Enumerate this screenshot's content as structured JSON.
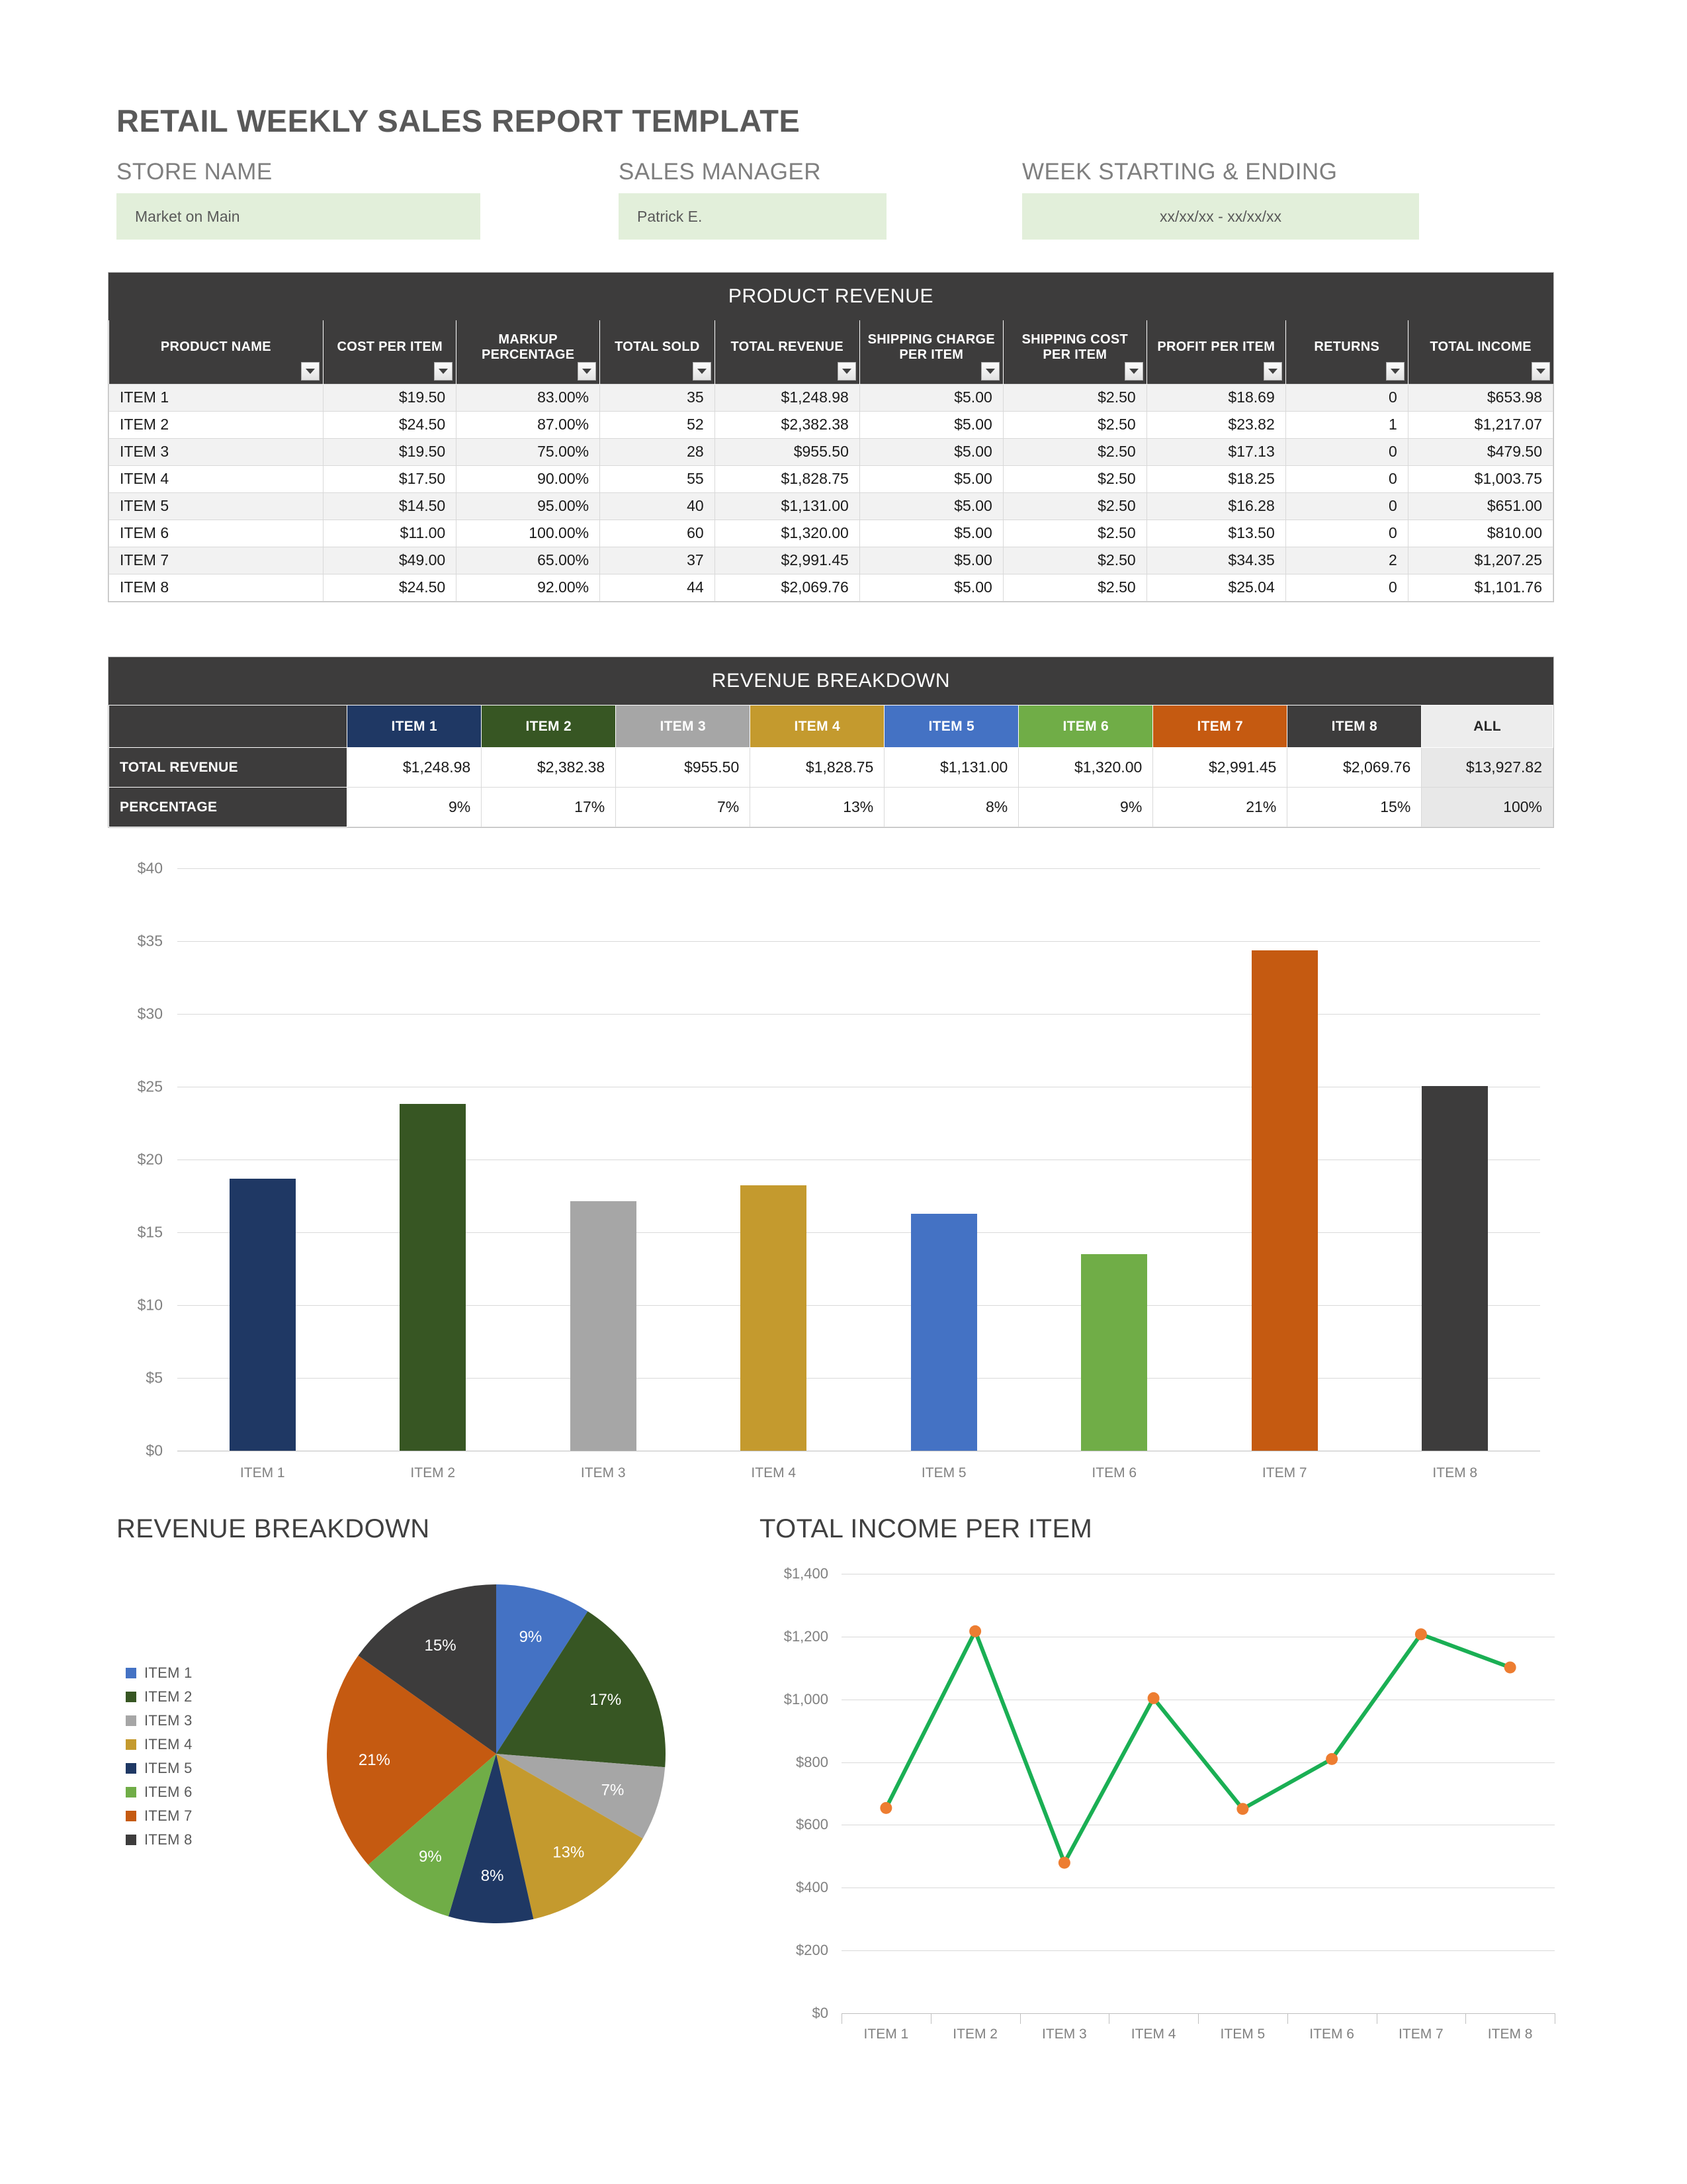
{
  "document": {
    "title": "RETAIL WEEKLY SALES REPORT TEMPLATE"
  },
  "header_fields": [
    {
      "label": "STORE NAME",
      "value": "Market on Main",
      "align": "left"
    },
    {
      "label": "SALES MANAGER",
      "value": "Patrick E.",
      "align": "left"
    },
    {
      "label": "WEEK STARTING & ENDING",
      "value": "xx/xx/xx - xx/xx/xx",
      "align": "center"
    }
  ],
  "product_revenue": {
    "band_title": "PRODUCT REVENUE",
    "columns": [
      "PRODUCT NAME",
      "COST PER ITEM",
      "MARKUP PERCENTAGE",
      "TOTAL SOLD",
      "TOTAL REVENUE",
      "SHIPPING CHARGE PER ITEM",
      "SHIPPING COST PER ITEM",
      "PROFIT PER ITEM",
      "RETURNS",
      "TOTAL INCOME"
    ],
    "rows": [
      [
        "ITEM 1",
        "$19.50",
        "83.00%",
        "35",
        "$1,248.98",
        "$5.00",
        "$2.50",
        "$18.69",
        "0",
        "$653.98"
      ],
      [
        "ITEM 2",
        "$24.50",
        "87.00%",
        "52",
        "$2,382.38",
        "$5.00",
        "$2.50",
        "$23.82",
        "1",
        "$1,217.07"
      ],
      [
        "ITEM 3",
        "$19.50",
        "75.00%",
        "28",
        "$955.50",
        "$5.00",
        "$2.50",
        "$17.13",
        "0",
        "$479.50"
      ],
      [
        "ITEM 4",
        "$17.50",
        "90.00%",
        "55",
        "$1,828.75",
        "$5.00",
        "$2.50",
        "$18.25",
        "0",
        "$1,003.75"
      ],
      [
        "ITEM 5",
        "$14.50",
        "95.00%",
        "40",
        "$1,131.00",
        "$5.00",
        "$2.50",
        "$16.28",
        "0",
        "$651.00"
      ],
      [
        "ITEM 6",
        "$11.00",
        "100.00%",
        "60",
        "$1,320.00",
        "$5.00",
        "$2.50",
        "$13.50",
        "0",
        "$810.00"
      ],
      [
        "ITEM 7",
        "$49.00",
        "65.00%",
        "37",
        "$2,991.45",
        "$5.00",
        "$2.50",
        "$34.35",
        "2",
        "$1,207.25"
      ],
      [
        "ITEM 8",
        "$24.50",
        "92.00%",
        "44",
        "$2,069.76",
        "$5.00",
        "$2.50",
        "$25.04",
        "0",
        "$1,101.76"
      ]
    ]
  },
  "revenue_breakdown_table": {
    "band_title": "REVENUE BREAKDOWN",
    "item_headers": [
      "ITEM 1",
      "ITEM 2",
      "ITEM 3",
      "ITEM 4",
      "ITEM 5",
      "ITEM 6",
      "ITEM 7",
      "ITEM 8"
    ],
    "all_header": "ALL",
    "row_labels": [
      "TOTAL REVENUE",
      "PERCENTAGE"
    ],
    "total_revenue": [
      "$1,248.98",
      "$2,382.38",
      "$955.50",
      "$1,828.75",
      "$1,131.00",
      "$1,320.00",
      "$2,991.45",
      "$2,069.76"
    ],
    "total_revenue_all": "$13,927.82",
    "percentage": [
      "9%",
      "17%",
      "7%",
      "13%",
      "8%",
      "9%",
      "21%",
      "15%"
    ],
    "percentage_all": "100%",
    "header_colors": [
      "#1F3864",
      "#375623",
      "#A6A6A6",
      "#C49A2E",
      "#4472C4",
      "#70AD47",
      "#C55A11",
      "#3D3C3C"
    ]
  },
  "section_titles": {
    "pie": "REVENUE BREAKDOWN",
    "line": "TOTAL INCOME PER ITEM"
  },
  "chart_data": [
    {
      "type": "bar",
      "title": "",
      "xlabel": "",
      "ylabel": "",
      "categories": [
        "ITEM 1",
        "ITEM 2",
        "ITEM 3",
        "ITEM 4",
        "ITEM 5",
        "ITEM 6",
        "ITEM 7",
        "ITEM 8"
      ],
      "values": [
        18.69,
        23.82,
        17.13,
        18.25,
        16.28,
        13.5,
        34.35,
        25.04
      ],
      "colors": [
        "#1F3864",
        "#375623",
        "#A6A6A6",
        "#C49A2E",
        "#4472C4",
        "#70AD47",
        "#C55A11",
        "#3D3C3C"
      ],
      "ylim": [
        0,
        40
      ],
      "yticks": [
        "$0",
        "$5",
        "$10",
        "$15",
        "$20",
        "$25",
        "$30",
        "$35",
        "$40"
      ],
      "ytick_values": [
        0,
        5,
        10,
        15,
        20,
        25,
        30,
        35,
        40
      ],
      "grid": true,
      "legend": "none"
    },
    {
      "type": "pie",
      "title": "REVENUE BREAKDOWN",
      "labels": [
        "ITEM 1",
        "ITEM 2",
        "ITEM 3",
        "ITEM 4",
        "ITEM 5",
        "ITEM 6",
        "ITEM 7",
        "ITEM 8"
      ],
      "values": [
        9,
        17,
        7,
        13,
        8,
        9,
        21,
        15
      ],
      "data_labels": [
        "9%",
        "17%",
        "7%",
        "13%",
        "8%",
        "9%",
        "21%",
        "15%"
      ],
      "colors": [
        "#4472C4",
        "#375623",
        "#A6A6A6",
        "#C49A2E",
        "#1F3864",
        "#70AD47",
        "#C55A11",
        "#3D3C3C"
      ],
      "legend": "left"
    },
    {
      "type": "line",
      "title": "TOTAL INCOME PER ITEM",
      "xlabel": "",
      "ylabel": "",
      "categories": [
        "ITEM 1",
        "ITEM 2",
        "ITEM 3",
        "ITEM 4",
        "ITEM 5",
        "ITEM 6",
        "ITEM 7",
        "ITEM 8"
      ],
      "values": [
        653.98,
        1217.07,
        479.5,
        1003.75,
        651.0,
        810.0,
        1207.25,
        1101.76
      ],
      "ylim": [
        0,
        1400
      ],
      "yticks": [
        "$0",
        "$200",
        "$400",
        "$600",
        "$800",
        "$1,000",
        "$1,200",
        "$1,400"
      ],
      "ytick_values": [
        0,
        200,
        400,
        600,
        800,
        1000,
        1200,
        1400
      ],
      "line_color": "#1AAF54",
      "marker_color": "#ED7D31",
      "grid": true,
      "legend": "none"
    }
  ]
}
